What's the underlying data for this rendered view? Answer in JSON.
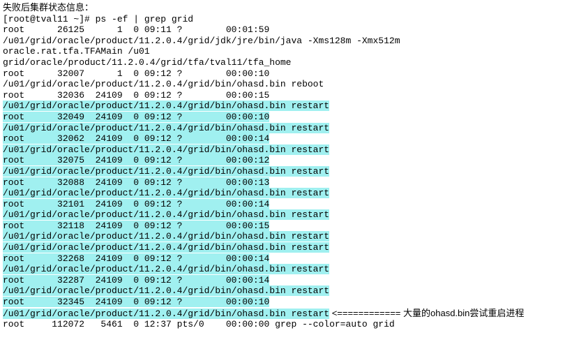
{
  "title": "失败后集群状态信息：",
  "prompt": "[root@tval11 ~]# ps -ef | grep grid",
  "lines": [
    {
      "hl": false,
      "text": "root      26125      1  0 09:11 ?        00:01:59"
    },
    {
      "hl": false,
      "text": "/u01/grid/oracle/product/11.2.0.4/grid/jdk/jre/bin/java -Xms128m -Xmx512m"
    },
    {
      "hl": false,
      "text": "oracle.rat.tfa.TFAMain /u01"
    },
    {
      "hl": false,
      "text": "grid/oracle/product/11.2.0.4/grid/tfa/tval11/tfa_home"
    },
    {
      "hl": false,
      "text": "root      32007      1  0 09:12 ?        00:00:10"
    },
    {
      "hl": false,
      "text": "/u01/grid/oracle/product/11.2.0.4/grid/bin/ohasd.bin reboot"
    },
    {
      "hl": false,
      "text": "root      32036  24109  0 09:12 ?        00:00:15"
    },
    {
      "hl": true,
      "text": "/u01/grid/oracle/product/11.2.0.4/grid/bin/ohasd.bin restart"
    },
    {
      "hl": true,
      "text": "root      32049  24109  0 09:12 ?        00:00:10"
    },
    {
      "hl": true,
      "text": "/u01/grid/oracle/product/11.2.0.4/grid/bin/ohasd.bin restart"
    },
    {
      "hl": true,
      "text": "root      32062  24109  0 09:12 ?        00:00:14"
    },
    {
      "hl": true,
      "text": "/u01/grid/oracle/product/11.2.0.4/grid/bin/ohasd.bin restart"
    },
    {
      "hl": true,
      "text": "root      32075  24109  0 09:12 ?        00:00:12"
    },
    {
      "hl": true,
      "text": "/u01/grid/oracle/product/11.2.0.4/grid/bin/ohasd.bin restart"
    },
    {
      "hl": true,
      "text": "root      32088  24109  0 09:12 ?        00:00:13"
    },
    {
      "hl": true,
      "text": "/u01/grid/oracle/product/11.2.0.4/grid/bin/ohasd.bin restart"
    },
    {
      "hl": true,
      "text": "root      32101  24109  0 09:12 ?        00:00:14"
    },
    {
      "hl": true,
      "text": "/u01/grid/oracle/product/11.2.0.4/grid/bin/ohasd.bin restart"
    },
    {
      "hl": true,
      "text": "root      32118  24109  0 09:12 ?        00:00:15"
    },
    {
      "hl": true,
      "text": "/u01/grid/oracle/product/11.2.0.4/grid/bin/ohasd.bin restart"
    },
    {
      "hl": true,
      "text": "/u01/grid/oracle/product/11.2.0.4/grid/bin/ohasd.bin restart"
    },
    {
      "hl": true,
      "text": "root      32268  24109  0 09:12 ?        00:00:14"
    },
    {
      "hl": true,
      "text": "/u01/grid/oracle/product/11.2.0.4/grid/bin/ohasd.bin restart"
    },
    {
      "hl": true,
      "text": "root      32287  24109  0 09:12 ?        00:00:14"
    },
    {
      "hl": true,
      "text": "/u01/grid/oracle/product/11.2.0.4/grid/bin/ohasd.bin restart"
    },
    {
      "hl": true,
      "text": "root      32345  24109  0 09:12 ?        00:00:10"
    }
  ],
  "annotated_line": {
    "text": "/u01/grid/oracle/product/11.2.0.4/grid/bin/ohasd.bin restart",
    "arrow": " <============ ",
    "note": "大量的ohasd.bin尝试重启进程"
  },
  "last_line": "root     112072   5461  0 12:37 pts/0    00:00:00 grep --color=auto grid"
}
